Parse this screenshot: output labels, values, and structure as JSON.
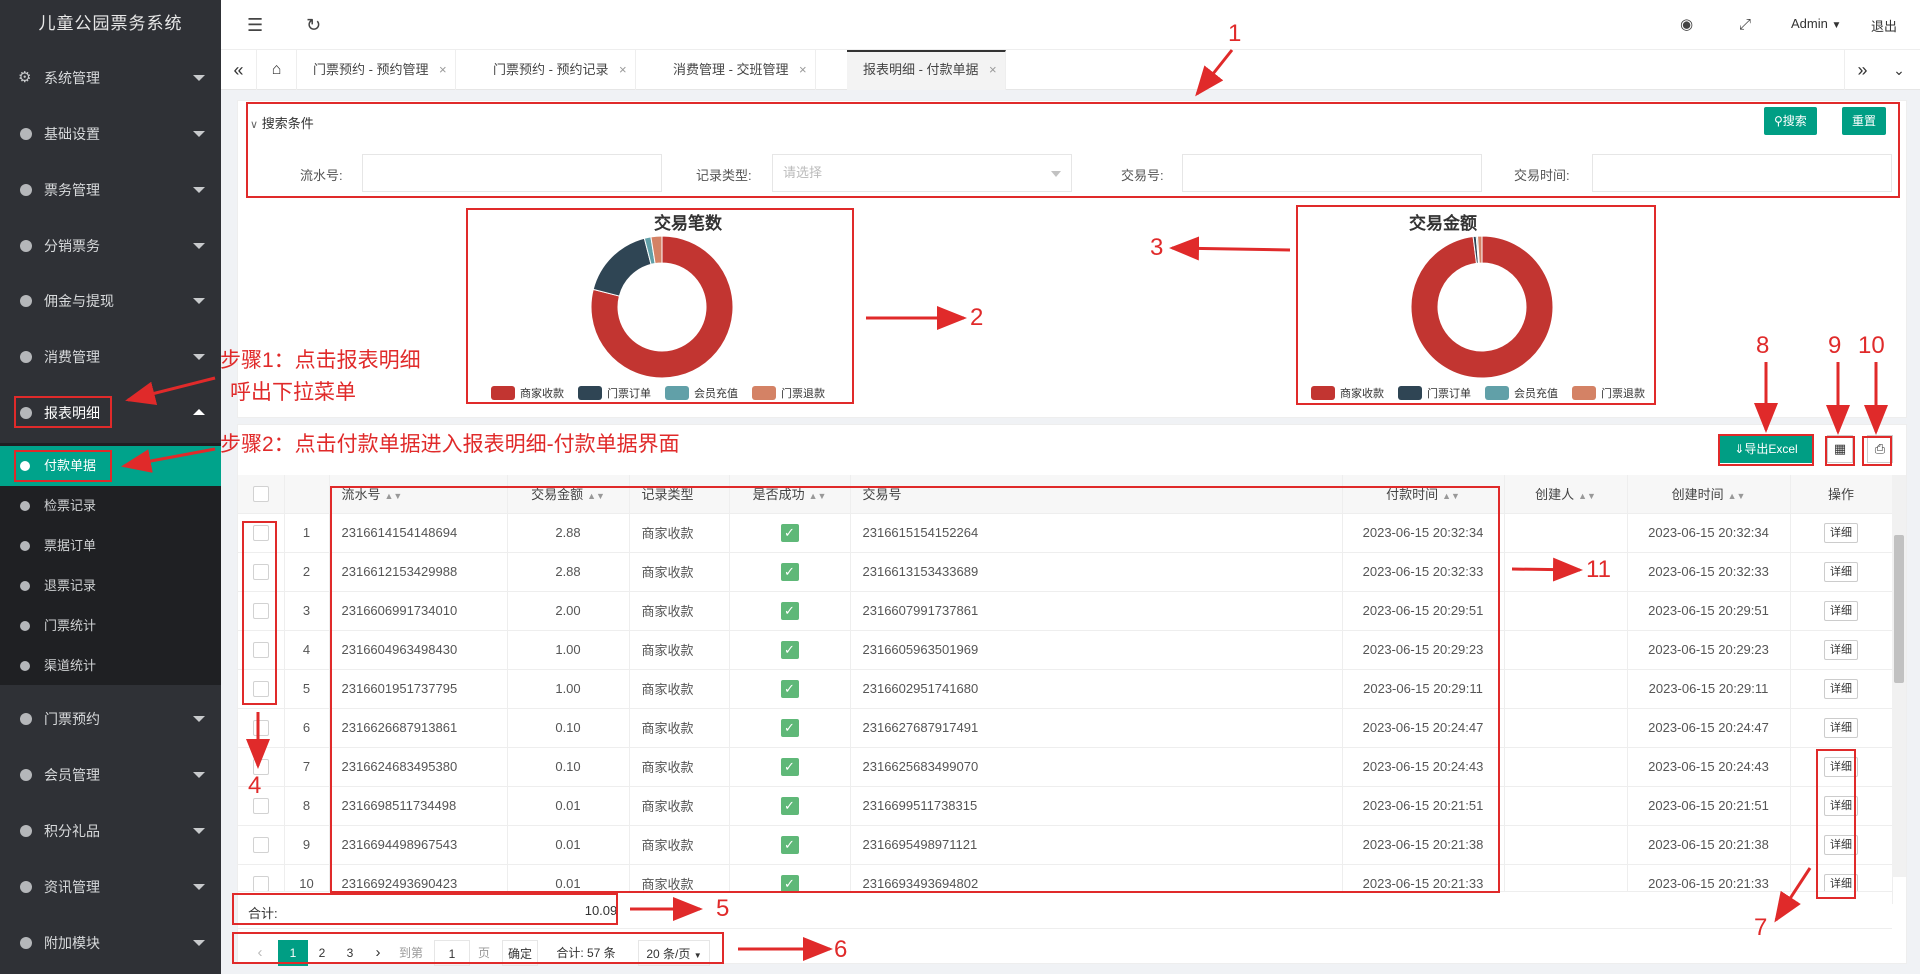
{
  "app": {
    "title": "儿童公园票务系统"
  },
  "sidebar": {
    "items": [
      {
        "label": "系统管理",
        "icon": "gear-icon"
      },
      {
        "label": "基础设置",
        "icon": "circle-icon"
      },
      {
        "label": "票务管理",
        "icon": "circle-icon"
      },
      {
        "label": "分销票务",
        "icon": "circle-icon"
      },
      {
        "label": "佣金与提现",
        "icon": "circle-icon"
      },
      {
        "label": "消费管理",
        "icon": "circle-icon"
      },
      {
        "label": "报表明细",
        "icon": "circle-icon"
      },
      {
        "label": "门票预约",
        "icon": "circle-icon"
      },
      {
        "label": "会员管理",
        "icon": "circle-icon"
      },
      {
        "label": "积分礼品",
        "icon": "circle-icon"
      },
      {
        "label": "资讯管理",
        "icon": "circle-icon"
      },
      {
        "label": "附加模块",
        "icon": "circle-icon"
      }
    ],
    "subitems": [
      {
        "label": "付款单据",
        "active": true
      },
      {
        "label": "检票记录"
      },
      {
        "label": "票据订单"
      },
      {
        "label": "退票记录"
      },
      {
        "label": "门票统计"
      },
      {
        "label": "渠道统计"
      }
    ]
  },
  "header": {
    "user": "Admin",
    "logout": "退出"
  },
  "tabs": [
    {
      "label": "门票预约 - 预约管理"
    },
    {
      "label": "门票预约 - 预约记录"
    },
    {
      "label": "消费管理 - 交班管理"
    },
    {
      "label": "报表明细 - 付款单据",
      "active": true
    }
  ],
  "search": {
    "title": "搜索条件",
    "search_btn": "搜索",
    "reset_btn": "重置",
    "fields": {
      "serial_label": "流水号:",
      "record_type_label": "记录类型:",
      "record_type_placeholder": "请选择",
      "trade_no_label": "交易号:",
      "trade_time_label": "交易时间:"
    }
  },
  "charts": {
    "colors": [
      "#c23531",
      "#2f4554",
      "#61a0a8",
      "#d48265"
    ],
    "legend": [
      "商家收款",
      "门票订单",
      "会员充值",
      "门票退款"
    ]
  },
  "chart_data": [
    {
      "type": "pie",
      "title": "交易笔数",
      "categories": [
        "商家收款",
        "门票订单",
        "会员充值",
        "门票退款"
      ],
      "values": [
        79,
        17,
        1.5,
        2.5
      ]
    },
    {
      "type": "pie",
      "title": "交易金额",
      "categories": [
        "商家收款",
        "门票订单",
        "会员充值",
        "门票退款"
      ],
      "values": [
        98,
        0.7,
        0.3,
        1
      ]
    }
  ],
  "toolbar": {
    "export_label": "导出Excel"
  },
  "table": {
    "columns": [
      "流水号",
      "交易金额",
      "记录类型",
      "是否成功",
      "交易号",
      "付款时间",
      "创建人",
      "创建时间",
      "操作"
    ],
    "detail_label": "详细",
    "rows": [
      {
        "no": "1",
        "serial": "2316614154148694",
        "amount": "2.88",
        "type": "商家收款",
        "trade_no": "2316615154152264",
        "pay_time": "2023-06-15 20:32:34",
        "creator": "",
        "created": "2023-06-15 20:32:34"
      },
      {
        "no": "2",
        "serial": "2316612153429988",
        "amount": "2.88",
        "type": "商家收款",
        "trade_no": "2316613153433689",
        "pay_time": "2023-06-15 20:32:33",
        "creator": "",
        "created": "2023-06-15 20:32:33"
      },
      {
        "no": "3",
        "serial": "2316606991734010",
        "amount": "2.00",
        "type": "商家收款",
        "trade_no": "2316607991737861",
        "pay_time": "2023-06-15 20:29:51",
        "creator": "",
        "created": "2023-06-15 20:29:51"
      },
      {
        "no": "4",
        "serial": "2316604963498430",
        "amount": "1.00",
        "type": "商家收款",
        "trade_no": "2316605963501969",
        "pay_time": "2023-06-15 20:29:23",
        "creator": "",
        "created": "2023-06-15 20:29:23"
      },
      {
        "no": "5",
        "serial": "2316601951737795",
        "amount": "1.00",
        "type": "商家收款",
        "trade_no": "2316602951741680",
        "pay_time": "2023-06-15 20:29:11",
        "creator": "",
        "created": "2023-06-15 20:29:11"
      },
      {
        "no": "6",
        "serial": "2316626687913861",
        "amount": "0.10",
        "type": "商家收款",
        "trade_no": "2316627687917491",
        "pay_time": "2023-06-15 20:24:47",
        "creator": "",
        "created": "2023-06-15 20:24:47"
      },
      {
        "no": "7",
        "serial": "2316624683495380",
        "amount": "0.10",
        "type": "商家收款",
        "trade_no": "2316625683499070",
        "pay_time": "2023-06-15 20:24:43",
        "creator": "",
        "created": "2023-06-15 20:24:43"
      },
      {
        "no": "8",
        "serial": "2316698511734498",
        "amount": "0.01",
        "type": "商家收款",
        "trade_no": "2316699511738315",
        "pay_time": "2023-06-15 20:21:51",
        "creator": "",
        "created": "2023-06-15 20:21:51"
      },
      {
        "no": "9",
        "serial": "2316694498967543",
        "amount": "0.01",
        "type": "商家收款",
        "trade_no": "2316695498971121",
        "pay_time": "2023-06-15 20:21:38",
        "creator": "",
        "created": "2023-06-15 20:21:38"
      },
      {
        "no": "10",
        "serial": "2316692493690423",
        "amount": "0.01",
        "type": "商家收款",
        "trade_no": "2316693493694802",
        "pay_time": "2023-06-15 20:21:33",
        "creator": "",
        "created": "2023-06-15 20:21:33"
      }
    ],
    "total_label": "合计:",
    "total_amount": "10.09"
  },
  "pagination": {
    "pages": [
      "1",
      "2",
      "3"
    ],
    "goto_label": "到第",
    "goto_value": "1",
    "page_unit": "页",
    "confirm": "确定",
    "total": "合计: 57 条",
    "page_size": "20 条/页"
  },
  "annotations": {
    "step1_line1": "步骤1：点击报表明细",
    "step1_line2": "呼出下拉菜单",
    "step2": "步骤2：点击付款单据进入报表明细-付款单据界面",
    "nums": [
      "1",
      "2",
      "3",
      "4",
      "5",
      "6",
      "7",
      "8",
      "9",
      "10",
      "11"
    ]
  }
}
